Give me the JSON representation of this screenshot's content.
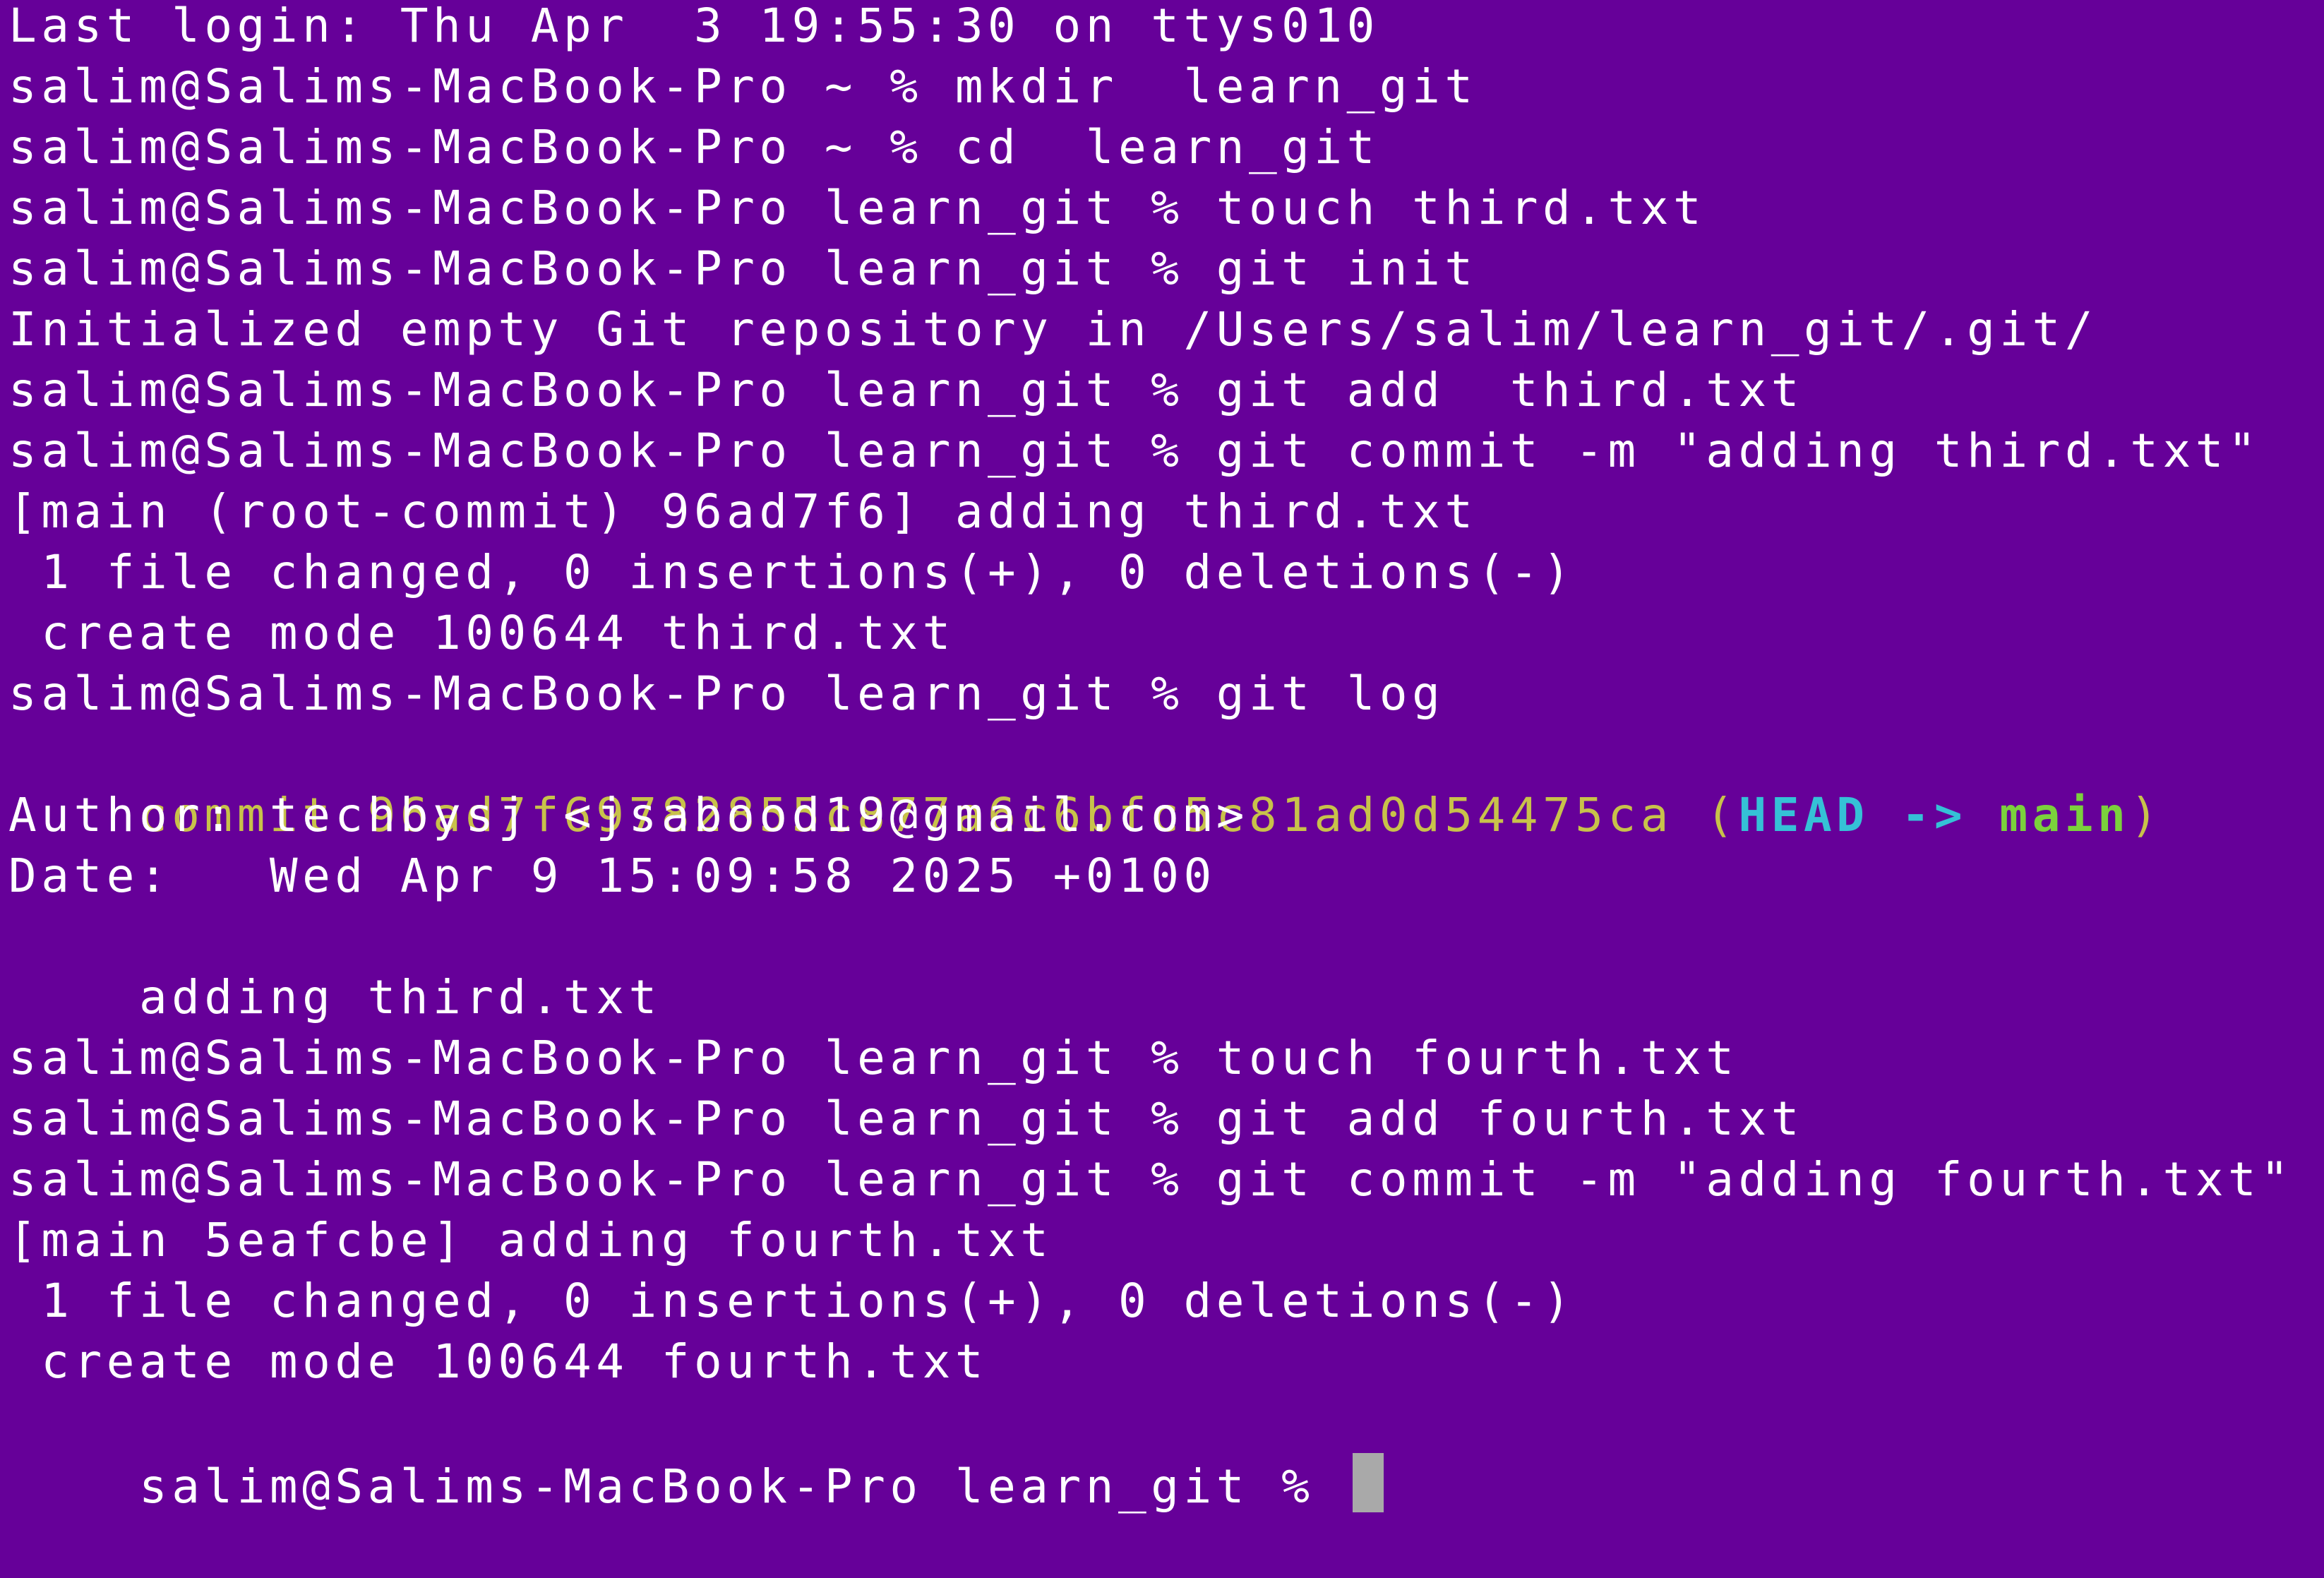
{
  "terminal": {
    "lines": [
      "Last login: Thu Apr  3 19:55:30 on ttys010",
      "salim@Salims-MacBook-Pro ~ % mkdir  learn_git",
      "salim@Salims-MacBook-Pro ~ % cd  learn_git",
      "salim@Salims-MacBook-Pro learn_git % touch third.txt",
      "salim@Salims-MacBook-Pro learn_git % git init",
      "Initialized empty Git repository in /Users/salim/learn_git/.git/",
      "salim@Salims-MacBook-Pro learn_git % git add  third.txt",
      "salim@Salims-MacBook-Pro learn_git % git commit -m \"adding third.txt\"",
      "[main (root-commit) 96ad7f6] adding third.txt",
      " 1 file changed, 0 insertions(+), 0 deletions(-)",
      " create mode 100644 third.txt",
      "salim@Salims-MacBook-Pro learn_git % git log"
    ],
    "log_line": {
      "prefix": "commit 96ad7f69782855c877a6c6bfc5c81ad0d54475ca (",
      "head": "HEAD -> ",
      "branch": "main",
      "suffix": ")"
    },
    "lines_after": [
      "Author: techbysj <jsabood19@gmail.com>",
      "Date:   Wed Apr 9 15:09:58 2025 +0100",
      "",
      "    adding third.txt",
      "salim@Salims-MacBook-Pro learn_git % touch fourth.txt",
      "salim@Salims-MacBook-Pro learn_git % git add fourth.txt",
      "salim@Salims-MacBook-Pro learn_git % git commit -m \"adding fourth.txt\"",
      "[main 5eafcbe] adding fourth.txt",
      " 1 file changed, 0 insertions(+), 0 deletions(-)",
      " create mode 100644 fourth.txt"
    ],
    "prompt": "salim@Salims-MacBook-Pro learn_git % ",
    "colors": {
      "background": "#660099",
      "text": "#ffffff",
      "commit_hash": "#c8c24a",
      "head": "#35c1d6",
      "branch": "#7bd13c",
      "cursor": "#a9a9a9"
    }
  }
}
